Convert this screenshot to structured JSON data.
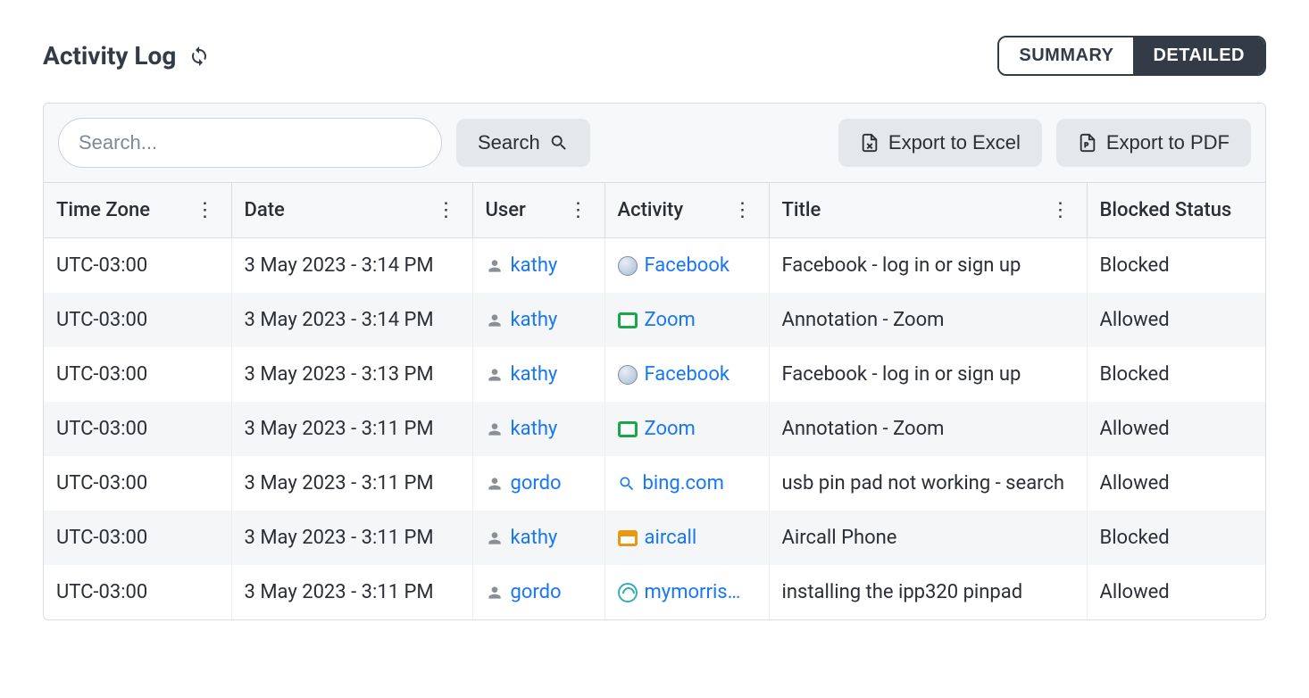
{
  "page": {
    "title": "Activity Log"
  },
  "viewToggle": {
    "summary": "SUMMARY",
    "detailed": "DETAILED",
    "active": "detailed"
  },
  "toolbar": {
    "searchPlaceholder": "Search...",
    "searchButton": "Search",
    "exportExcel": "Export to Excel",
    "exportPdf": "Export to PDF"
  },
  "columns": {
    "timezone": "Time Zone",
    "date": "Date",
    "user": "User",
    "activity": "Activity",
    "title": "Title",
    "blockedStatus": "Blocked Status"
  },
  "rows": [
    {
      "timezone": "UTC-03:00",
      "date": "3 May 2023 - 3:14 PM",
      "user": "kathy",
      "activity": "Facebook",
      "activityIcon": "globe",
      "title": "Facebook - log in or sign up",
      "status": "Blocked"
    },
    {
      "timezone": "UTC-03:00",
      "date": "3 May 2023 - 3:14 PM",
      "user": "kathy",
      "activity": "Zoom",
      "activityIcon": "app-green",
      "title": "Annotation - Zoom",
      "status": "Allowed"
    },
    {
      "timezone": "UTC-03:00",
      "date": "3 May 2023 - 3:13 PM",
      "user": "kathy",
      "activity": "Facebook",
      "activityIcon": "globe",
      "title": "Facebook - log in or sign up",
      "status": "Blocked"
    },
    {
      "timezone": "UTC-03:00",
      "date": "3 May 2023 - 3:11 PM",
      "user": "kathy",
      "activity": "Zoom",
      "activityIcon": "app-green",
      "title": "Annotation - Zoom",
      "status": "Allowed"
    },
    {
      "timezone": "UTC-03:00",
      "date": "3 May 2023 - 3:11 PM",
      "user": "gordo",
      "activity": "bing.com",
      "activityIcon": "search",
      "title": "usb pin pad not working - search",
      "status": "Allowed"
    },
    {
      "timezone": "UTC-03:00",
      "date": "3 May 2023 - 3:11 PM",
      "user": "kathy",
      "activity": "aircall",
      "activityIcon": "app-orange",
      "title": "Aircall Phone",
      "status": "Blocked"
    },
    {
      "timezone": "UTC-03:00",
      "date": "3 May 2023 - 3:11 PM",
      "user": "gordo",
      "activity": "mymorris…",
      "activityIcon": "swirl",
      "title": "installing the ipp320 pinpad",
      "status": "Allowed"
    }
  ]
}
